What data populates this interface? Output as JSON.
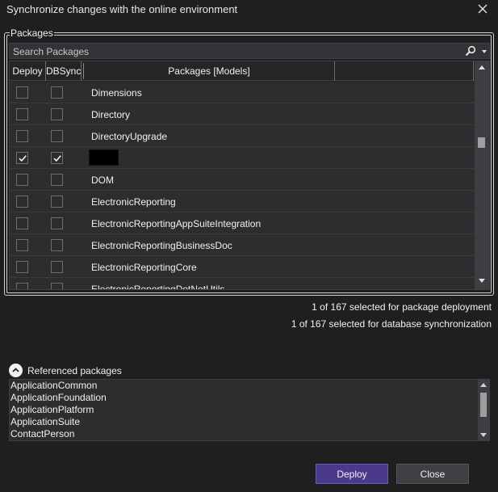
{
  "dialog": {
    "title": "Synchronize changes with the online environment"
  },
  "packages_group": {
    "legend": "Packages",
    "search_placeholder": "Search Packages",
    "columns": {
      "deploy": "Deploy",
      "dbsync": "DBSync",
      "packages": "Packages [Models]"
    },
    "rows": [
      {
        "name": "Dimensions",
        "deploy": false,
        "dbsync": false,
        "redacted": false
      },
      {
        "name": "Directory",
        "deploy": false,
        "dbsync": false,
        "redacted": false
      },
      {
        "name": "DirectoryUpgrade",
        "deploy": false,
        "dbsync": false,
        "redacted": false
      },
      {
        "name": "",
        "deploy": true,
        "dbsync": true,
        "redacted": true
      },
      {
        "name": "DOM",
        "deploy": false,
        "dbsync": false,
        "redacted": false
      },
      {
        "name": "ElectronicReporting",
        "deploy": false,
        "dbsync": false,
        "redacted": false
      },
      {
        "name": "ElectronicReportingAppSuiteIntegration",
        "deploy": false,
        "dbsync": false,
        "redacted": false
      },
      {
        "name": "ElectronicReportingBusinessDoc",
        "deploy": false,
        "dbsync": false,
        "redacted": false
      },
      {
        "name": "ElectronicReportingCore",
        "deploy": false,
        "dbsync": false,
        "redacted": false
      },
      {
        "name": "ElectronicReportingDotNetUtils",
        "deploy": false,
        "dbsync": false,
        "redacted": false
      }
    ]
  },
  "summary": {
    "deploy_text": "1 of 167 selected for package deployment",
    "dbsync_text": "1 of 167 selected for database synchronization"
  },
  "referenced": {
    "label": "Referenced packages",
    "items": [
      "ApplicationCommon",
      "ApplicationFoundation",
      "ApplicationPlatform",
      "ApplicationSuite",
      "ContactPerson"
    ]
  },
  "buttons": {
    "deploy": "Deploy",
    "close": "Close"
  },
  "colors": {
    "background": "#1f1f1f",
    "accent_button": "#4b3a8c",
    "checkbox_border": "#6e6e6e"
  },
  "icons": {
    "close": "close-icon",
    "search": "search-icon",
    "checkmark": "checkmark-icon",
    "collapse": "chevron-up-icon"
  }
}
